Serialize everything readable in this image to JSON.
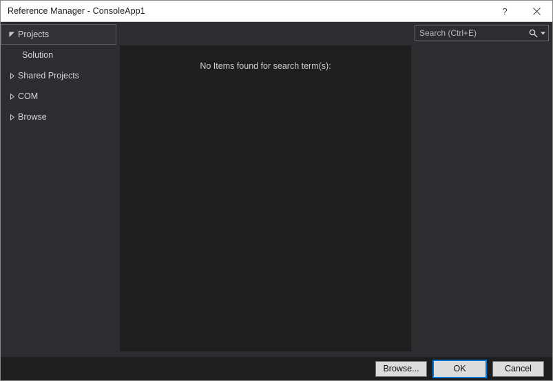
{
  "window": {
    "title": "Reference Manager - ConsoleApp1",
    "help_button_label": "?",
    "close_button_label": "Close",
    "help_icon": "question-mark-icon",
    "close_icon": "close-icon"
  },
  "sidebar": {
    "items": [
      {
        "label": "Projects",
        "state": "expanded",
        "level": 0,
        "selected": true,
        "expander_icon": "triangle-down-icon"
      },
      {
        "label": "Solution",
        "state": "leaf",
        "level": 1,
        "selected": false,
        "expander_icon": "none"
      },
      {
        "label": "Shared Projects",
        "state": "collapsed",
        "level": 0,
        "selected": false,
        "expander_icon": "triangle-right-icon"
      },
      {
        "label": "COM",
        "state": "collapsed",
        "level": 0,
        "selected": false,
        "expander_icon": "triangle-right-icon"
      },
      {
        "label": "Browse",
        "state": "collapsed",
        "level": 0,
        "selected": false,
        "expander_icon": "triangle-right-icon"
      }
    ]
  },
  "main": {
    "empty_message": "No Items found for search term(s):"
  },
  "search": {
    "placeholder": "Search (Ctrl+E)",
    "value": "",
    "icon": "magnifier-icon",
    "dropdown_icon": "chevron-down-icon"
  },
  "footer": {
    "browse_label": "Browse...",
    "ok_label": "OK",
    "cancel_label": "Cancel"
  },
  "colors": {
    "titlebar_background": "#ffffff",
    "titlebar_text": "#1b1b1b",
    "dialog_background": "#2d2d30",
    "list_background": "#1e1e1e",
    "footer_background": "#1e1e1e",
    "text_primary": "#d6d6d6",
    "selection_border": "#5a5a5c",
    "focus_accent": "#0078d7",
    "button_face": "#dcdcdc"
  }
}
